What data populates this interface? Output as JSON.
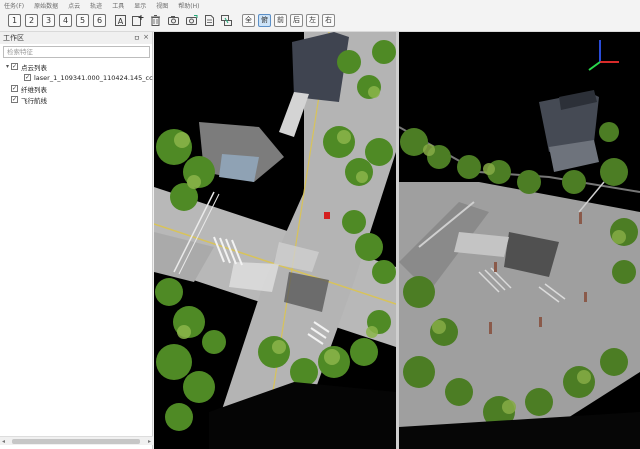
{
  "menu": {
    "items": [
      "任务(F)",
      "原始数据",
      "点云",
      "轨迹",
      "工具",
      "显示",
      "视图",
      "帮助(H)"
    ]
  },
  "toolbar": {
    "numbers": [
      "1",
      "2",
      "3",
      "4",
      "5",
      "6"
    ],
    "icons": [
      "text-tool-icon",
      "add-icon",
      "delete-icon",
      "camera-icon",
      "camera-sync-icon",
      "file-export-icon",
      "layers-icon"
    ],
    "views": [
      "全",
      "俯",
      "前",
      "后",
      "左",
      "右"
    ],
    "active_view": "俯"
  },
  "panel": {
    "title": "工作区",
    "pin": "ㅁ",
    "close": "×",
    "search_placeholder": "检索特征",
    "tree": {
      "root_label": "点云列表",
      "child_label": "laser_1_109341.000_110424.145_cc",
      "item2_label": "纤维列表",
      "item3_label": "飞行航线"
    }
  },
  "colors": {
    "accent": "#cde3f7",
    "vegetation": "#5e8f2c",
    "road": "#bdbdbd",
    "background": "#000000"
  }
}
